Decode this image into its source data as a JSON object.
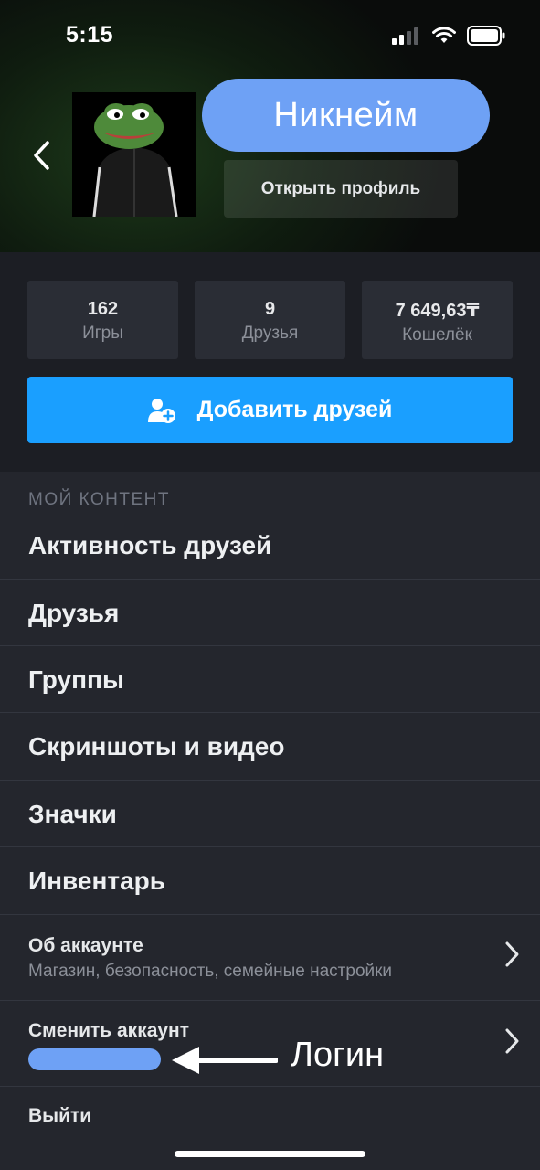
{
  "status": {
    "time": "5:15"
  },
  "profile": {
    "nickname": "Никнейм",
    "open_profile_label": "Открыть профиль"
  },
  "stats": [
    {
      "value": "162",
      "label": "Игры"
    },
    {
      "value": "9",
      "label": "Друзья"
    },
    {
      "value": "7 649,63₸",
      "label": "Кошелёк"
    }
  ],
  "add_friends_label": "Добавить друзей",
  "menu": {
    "section_title": "МОЙ КОНТЕНТ",
    "items": [
      {
        "label": "Активность друзей"
      },
      {
        "label": "Друзья"
      },
      {
        "label": "Группы"
      },
      {
        "label": "Скриншоты и видео"
      },
      {
        "label": "Значки"
      },
      {
        "label": "Инвентарь"
      }
    ],
    "account": {
      "title": "Об аккаунте",
      "subtitle": "Магазин, безопасность, семейные настройки"
    },
    "switch_account": {
      "title": "Сменить аккаунт",
      "annotation": "Логин"
    },
    "logout": "Выйти"
  },
  "colors": {
    "accent": "#1a9fff",
    "highlight": "#6ea1f5"
  }
}
